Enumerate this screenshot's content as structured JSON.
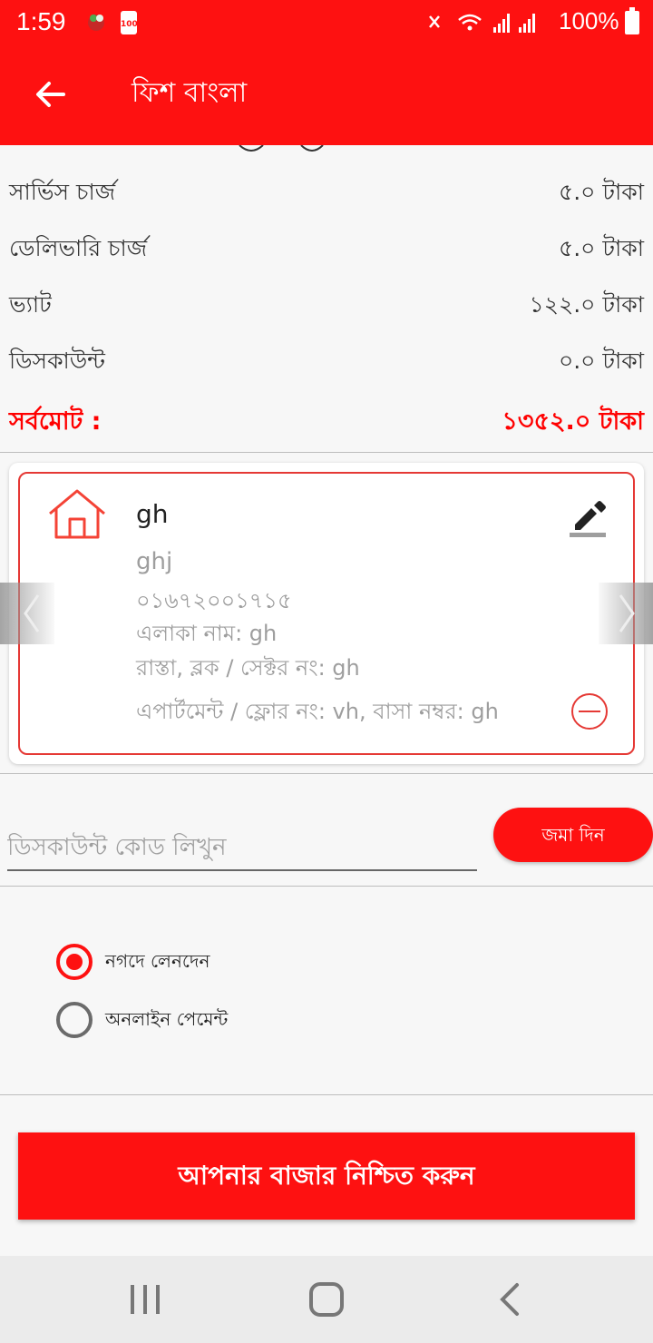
{
  "status_bar": {
    "time": "1:59",
    "battery_percent": "100%",
    "notif_badge": "100"
  },
  "app_bar": {
    "title": "ফিশ বাংলা"
  },
  "summary": [
    {
      "label": "সার্ভিস চার্জ",
      "value": "৫.০ টাকা"
    },
    {
      "label": "ডেলিভারি চার্জ",
      "value": "৫.০ টাকা"
    },
    {
      "label": "ভ্যাট",
      "value": "১২২.০ টাকা"
    },
    {
      "label": "ডিসকাউন্ট",
      "value": "০.০ টাকা"
    }
  ],
  "total": {
    "label": "সর্বমোট :",
    "value": "১৩৫২.০ টাকা"
  },
  "address": {
    "name": "gh",
    "line1": "ghj",
    "phone": "০১৬৭২০০১৭১৫",
    "area": "এলাকা নাম: gh",
    "road": "রাস্তা, ব্লক / সেক্টর নং: gh",
    "apartment": "এপার্টমেন্ট / ফ্লোর নং: vh, বাসা নম্বর: gh"
  },
  "discount": {
    "placeholder": "ডিসকাউন্ট কোড লিখুন",
    "apply_label": "জমা দিন"
  },
  "payment": {
    "options": [
      {
        "label": "নগদে লেনদেন",
        "selected": true
      },
      {
        "label": "অনলাইন পেমেন্ট",
        "selected": false
      }
    ]
  },
  "confirm_label": "আপনার বাজার নিশ্চিত করুন",
  "colors": {
    "primary": "#fe1111",
    "accent_border": "#e53935"
  }
}
